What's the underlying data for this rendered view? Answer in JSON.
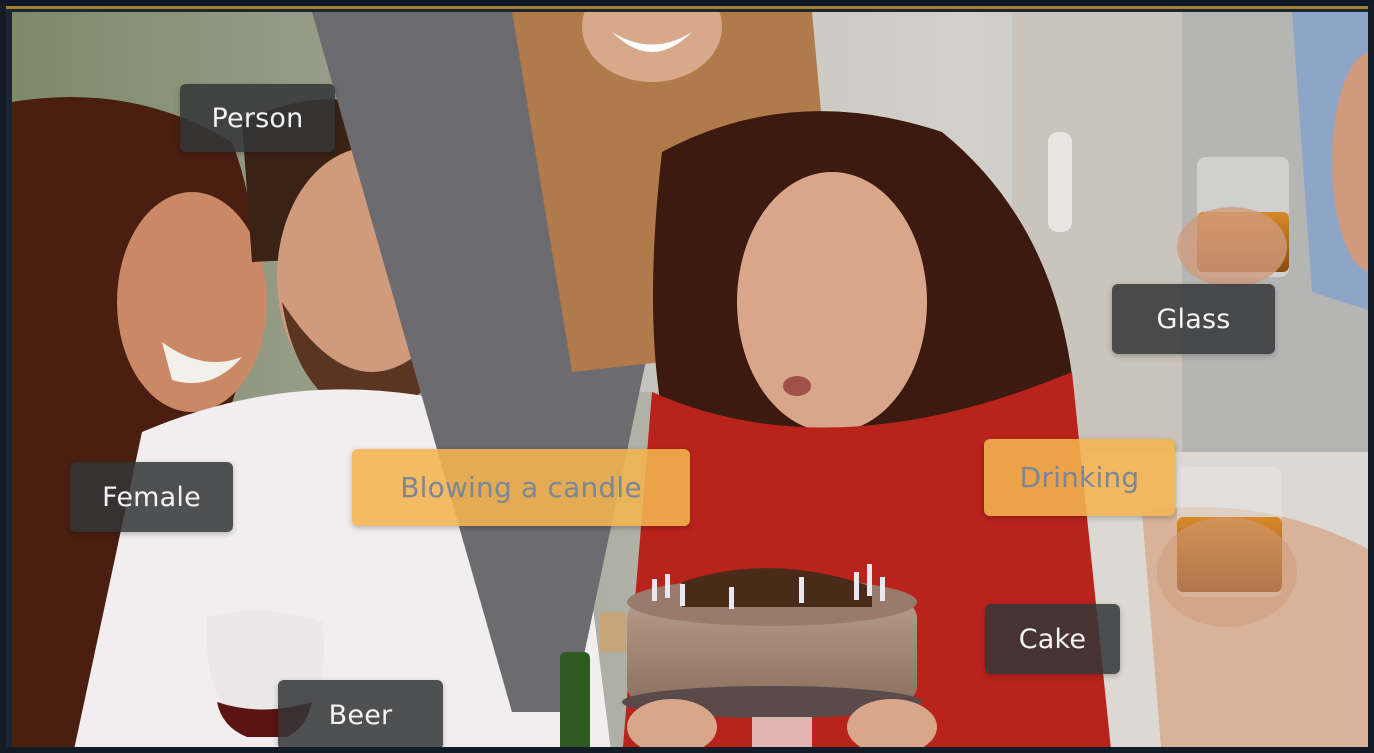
{
  "scene": {
    "icon": "party-photo",
    "colors": {
      "frame": "#121b26",
      "object_label_bg": "#343638",
      "object_label_text": "#f3f3f3",
      "action_label_bg": "#f3b450",
      "action_label_text": "#7b8796"
    }
  },
  "labels": {
    "objects": {
      "person": "Person",
      "glass": "Glass",
      "female": "Female",
      "cake": "Cake",
      "beer": "Beer"
    },
    "actions": {
      "blowing_candle": "Blowing a candle",
      "drinking": "Drinking"
    }
  }
}
